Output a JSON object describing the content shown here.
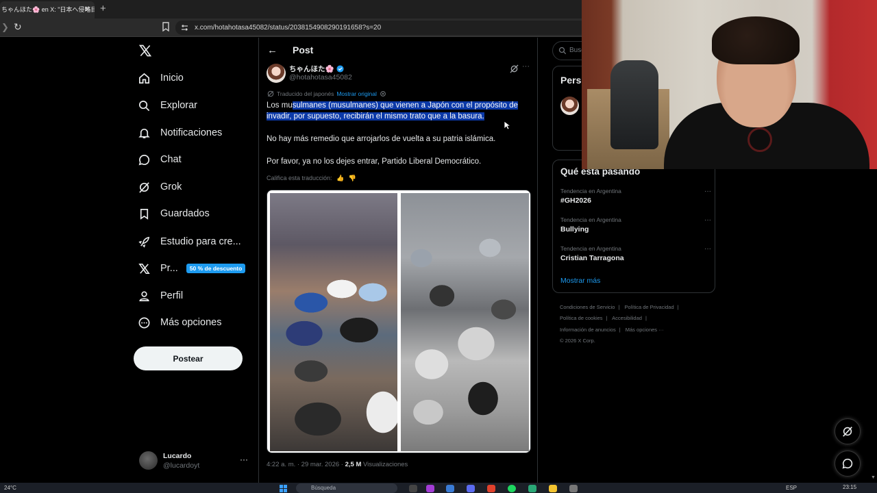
{
  "browser": {
    "tab_title": "ちゃんほた🌸 en X: \"日本へ侵略目",
    "tab_close": "✕",
    "new_tab": "+",
    "url": "x.com/hotahotasa45082/status/2038154908290191658?s=20"
  },
  "nav": {
    "items": [
      {
        "label": "Inicio",
        "icon": "home-icon"
      },
      {
        "label": "Explorar",
        "icon": "search-icon"
      },
      {
        "label": "Notificaciones",
        "icon": "bell-icon"
      },
      {
        "label": "Chat",
        "icon": "chat-icon"
      },
      {
        "label": "Grok",
        "icon": "grok-icon"
      },
      {
        "label": "Guardados",
        "icon": "bookmark-icon"
      },
      {
        "label": "Estudio para cre...",
        "icon": "rocket-icon"
      },
      {
        "label": "Pr...",
        "icon": "x-icon",
        "badge": "50 % de descuento"
      },
      {
        "label": "Perfil",
        "icon": "person-icon"
      },
      {
        "label": "Más opciones",
        "icon": "more-circle-icon"
      }
    ],
    "post_button": "Postear",
    "account": {
      "name": "Lucardo",
      "handle": "@lucardoyt",
      "more": "···"
    }
  },
  "post": {
    "header_title": "Post",
    "author_name": "ちゃんほた🌸",
    "author_handle": "@hotahotasa45082",
    "more": "···",
    "translated_label": "Traducido del japonés",
    "show_original": "Mostrar original",
    "text_prefix": "Los mu",
    "text_highlighted": "sulmanes (musulmanes) que vienen a Japón con el propósito de invadir, por supuesto, recibirán el mismo trato que a la basura.",
    "paragraph_2": "No hay más remedio que arrojarlos de vuelta a su patria islámica.",
    "paragraph_3": "Por favor, ya no los dejes entrar, Partido Liberal Democrático.",
    "rate_translation": "Califica esta traducción:",
    "timestamp": "4:22 a. m. · 29 mar. 2026 ·",
    "views_count": "2,5 M",
    "views_label": "Visualizaciones"
  },
  "sidebar": {
    "search_placeholder": "Buscar",
    "who_to_follow_title": "Perso",
    "trends_title": "Qué está pasando",
    "trends": [
      {
        "context": "Tendencia en Argentina",
        "topic": "#GH2026"
      },
      {
        "context": "Tendencia en Argentina",
        "topic": "Bullying"
      },
      {
        "context": "Tendencia en Argentina",
        "topic": "Cristian Tarragona"
      }
    ],
    "trend_more": "···",
    "show_more": "Mostrar más",
    "footer_links": [
      "Condiciones de Servicio",
      "|",
      "Política de Privacidad",
      "|",
      "Política de cookies",
      "|",
      "Accesibilidad",
      "|",
      "Información de anuncios",
      "|",
      "Más opciones ···",
      "© 2026 X Corp."
    ]
  },
  "taskbar": {
    "weather": "24°C",
    "search": "Búsqueda",
    "language": "ESP",
    "time": "23:15"
  },
  "colors": {
    "accent": "#1d9bf0",
    "highlight": "#0b39a8",
    "muted": "#71767b",
    "border": "#2f3336"
  }
}
